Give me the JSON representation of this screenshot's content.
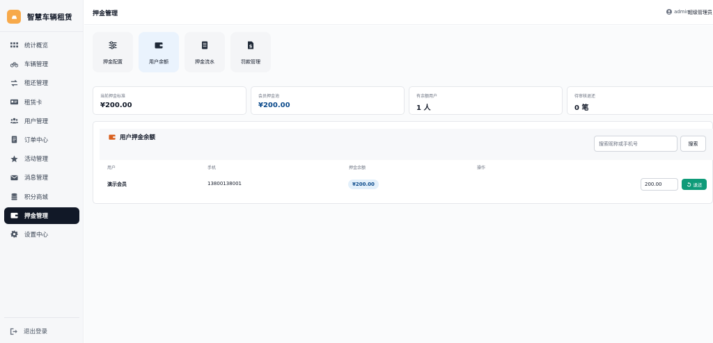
{
  "brand": {
    "title": "智慧车辆租赁"
  },
  "sidebar": {
    "items": [
      {
        "label": "统计概览",
        "icon": "grid-icon"
      },
      {
        "label": "车辆管理",
        "icon": "bicycle-icon"
      },
      {
        "label": "租还管理",
        "icon": "swap-icon"
      },
      {
        "label": "租赁卡",
        "icon": "card-icon"
      },
      {
        "label": "用户管理",
        "icon": "users-icon"
      },
      {
        "label": "订单中心",
        "icon": "document-icon"
      },
      {
        "label": "活动管理",
        "icon": "star-icon"
      },
      {
        "label": "消息管理",
        "icon": "envelope-icon"
      },
      {
        "label": "积分商城",
        "icon": "coins-icon"
      },
      {
        "label": "押金管理",
        "icon": "wallet-icon",
        "active": true
      },
      {
        "label": "设置中心",
        "icon": "gear-icon"
      }
    ],
    "logout": "退出登录"
  },
  "header": {
    "title": "押金管理",
    "user": "admin",
    "role": "超级管理员"
  },
  "tabs": [
    {
      "label": "押金配置",
      "icon": "sliders-icon"
    },
    {
      "label": "用户余额",
      "icon": "wallet-icon",
      "active": true
    },
    {
      "label": "押金流水",
      "icon": "list-icon"
    },
    {
      "label": "罚款管理",
      "icon": "fine-icon"
    }
  ],
  "stats": [
    {
      "label": "当前押金标准",
      "value": "¥200.00"
    },
    {
      "label": "会员押金池",
      "value": "¥200.00"
    },
    {
      "label": "有余额用户",
      "value": "1 人"
    },
    {
      "label": "待审核退还",
      "value": "0 笔"
    }
  ],
  "panel": {
    "title": "用户押金余额",
    "search_placeholder": "搜索昵称或手机号",
    "search_button": "搜索",
    "columns": [
      "用户",
      "手机",
      "押金余额",
      "操作"
    ],
    "rows": [
      {
        "user": "演示会员",
        "phone": "13800138001",
        "balance": "¥200.00",
        "refund_amount": "200.00",
        "action": "退还"
      }
    ]
  },
  "colors": {
    "sidebar_active": "#111827",
    "brand_logo": "#f7a94a",
    "refund_button": "#0f9b79",
    "badge_bg": "#e3f0fb",
    "panel_icon": "#d9601f"
  }
}
